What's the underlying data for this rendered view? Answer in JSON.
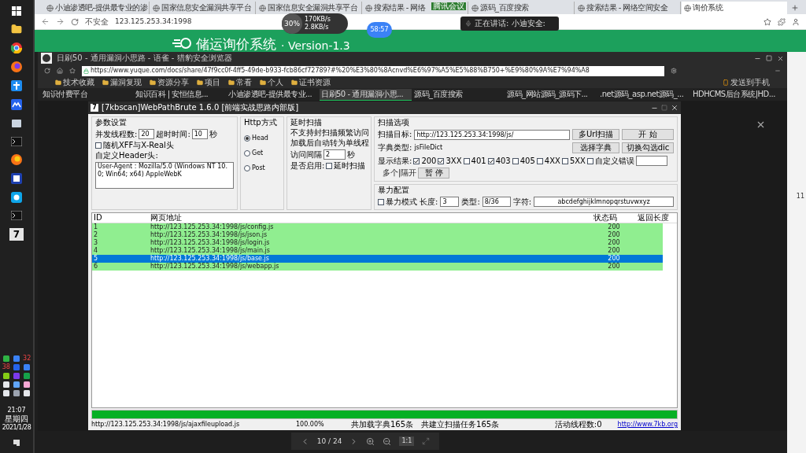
{
  "taskbar": {
    "app_label": "7",
    "badges": [
      "32",
      "38"
    ],
    "clock": {
      "time": "21:07",
      "weekday": "星期四",
      "date": "2021/1/28"
    }
  },
  "browser": {
    "tabs": [
      {
        "title": "小迪渗透吧-提供最专业的渗",
        "selected": false
      },
      {
        "title": "国家信息安全漏洞共享平台",
        "selected": false
      },
      {
        "title": "国家信息安全漏洞共享平台",
        "selected": false
      },
      {
        "title": "搜索结果 - 网络",
        "selected": false
      },
      {
        "title": "源码_百度搜索",
        "selected": false
      },
      {
        "title": "搜索结果 - 网络空间安全",
        "selected": false
      },
      {
        "title": "询价系统",
        "selected": true
      }
    ],
    "security": "不安全",
    "url": "123.125.253.34:1998"
  },
  "page_header": {
    "title": "储运询价系统",
    "version": "· Version-1.3"
  },
  "meeting": {
    "percent": "30%",
    "up": "170KB/s",
    "down": "2.8KB/s",
    "timer": "58:57",
    "speaking": "正在讲话: 小迪安全:",
    "app": "腾讯会议"
  },
  "viewer": {
    "page": "10 / 24",
    "actual_size": "1:1"
  },
  "right_edge": {
    "cell": "11"
  },
  "inner_browser": {
    "title": "日刷50 - 通用漏洞小思路 - 语雀 - 猎豹安全浏览器",
    "url": "https://www.yuque.com/docs/share/47f9cc0f-4ff5-49de-b933-fcb86cf72789?#%20%E3%80%8Acnvd%E6%97%A5%E5%88%B750+%E9%80%9A%E7%94%A8",
    "bookmarks": [
      "技术收藏",
      "漏洞复现",
      "资源分享",
      "项目",
      "常看",
      "个人",
      "证书资源"
    ],
    "send_to_phone": "发送到手机",
    "tabs": [
      {
        "title": "知识付费平台",
        "selected": false
      },
      {
        "title": "知识百科 | 安恒信息...",
        "selected": false
      },
      {
        "title": "小迪渗透吧-提供最专业...",
        "selected": false
      },
      {
        "title": "日刷50 - 通用漏洞小思...",
        "selected": true
      },
      {
        "title": "源码_百度搜索",
        "selected": false
      },
      {
        "title": "源码_网站源码_源码下...",
        "selected": false
      },
      {
        "title": ".net源码_asp.net源码_...",
        "selected": false
      },
      {
        "title": "HDHCMS后台系统|HD...",
        "selected": false
      }
    ]
  },
  "tool": {
    "logo": "7",
    "title": "[7kbscan]WebPathBrute 1.6.0 [前端实战思路内部版]",
    "params": {
      "heading": "参数设置",
      "threads_label": "并发线程数:",
      "threads": "20",
      "timeout_label": "超时时间:",
      "timeout": "10",
      "timeout_unit": "秒",
      "random_xff": {
        "label": "随机XFF与X-Real头",
        "checked": false
      },
      "header_label": "自定义Header头:",
      "header_value": "User-Agent : Mozilla/5.0 (Windows NT 10.0; Win64; x64) AppleWebK"
    },
    "http": {
      "heading": "Http方式",
      "methods": [
        {
          "label": "Head",
          "selected": true
        },
        {
          "label": "Get",
          "selected": false
        },
        {
          "label": "Post",
          "selected": false
        }
      ]
    },
    "delay": {
      "heading": "延时扫描",
      "note1": "不支持封扫描频繁访问",
      "note2": "加载后自动转为单线程",
      "interval_label": "访问间隔",
      "interval": "2",
      "interval_unit": "秒",
      "enable_label": "是否启用:",
      "enable": {
        "label": "延时扫描",
        "checked": false
      }
    },
    "scan": {
      "heading": "扫描选项",
      "target_label": "扫描目标:",
      "target": "http://123.125.253.34:1998/js/",
      "multi_url": "多Url扫描",
      "start": "开 始",
      "dict_label": "字典类型:",
      "dict": "jsFileDict",
      "choose_dict": "选择字典",
      "toggle_dic": "切换勾选dic",
      "show_label": "显示结果:",
      "codes": [
        {
          "label": "200",
          "checked": true
        },
        {
          "label": "3XX",
          "checked": true
        },
        {
          "label": "401",
          "checked": false
        },
        {
          "label": "403",
          "checked": true
        },
        {
          "label": "405",
          "checked": false
        },
        {
          "label": "4XX",
          "checked": false
        },
        {
          "label": "5XX",
          "checked": false
        },
        {
          "label": "自定义错误",
          "checked": false
        }
      ],
      "sep_hint": "多个|隔开",
      "pause": "暂 停"
    },
    "brute": {
      "heading": "暴力配置",
      "mode": {
        "label": "暴力模式",
        "checked": false
      },
      "length_label": "长度:",
      "length": "3",
      "type_label": "类型:",
      "type": "8/36",
      "chars_label": "字符:",
      "chars": "abcdefghijklmnopqrstuvwxyz"
    },
    "table": {
      "columns": [
        "ID",
        "网页地址",
        "状态码",
        "返回长度"
      ],
      "rows": [
        {
          "id": "1",
          "url": "http://123.125.253.34:1998/js/config.js",
          "status": "200",
          "selected": false
        },
        {
          "id": "2",
          "url": "http://123.125.253.34:1998/js/json.js",
          "status": "200",
          "selected": false
        },
        {
          "id": "3",
          "url": "http://123.125.253.34:1998/js/login.js",
          "status": "200",
          "selected": false
        },
        {
          "id": "4",
          "url": "http://123.125.253.34:1998/js/main.js",
          "status": "200",
          "selected": false
        },
        {
          "id": "5",
          "url": "http://123.125.253.34:1998/js/base.js",
          "status": "200",
          "selected": true
        },
        {
          "id": "6",
          "url": "http://123.125.253.34:1998/js/webapp.js",
          "status": "200",
          "selected": false
        }
      ]
    },
    "progress": {
      "level": 1
    },
    "status": {
      "current": "http://123.125.253.34:1998/js/ajaxfileupload.js",
      "percent": "100.00%",
      "dict_count": "共加载字典165条",
      "task_count": "共建立扫描任务165条",
      "threads": "活动线程数:0",
      "link": "http://www.7kb.org"
    }
  }
}
